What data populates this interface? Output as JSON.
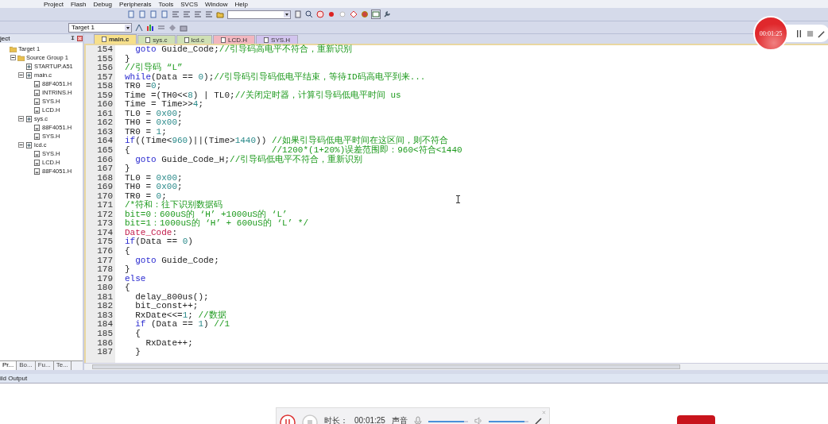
{
  "menu": [
    "Project",
    "Flash",
    "Debug",
    "Peripherals",
    "Tools",
    "SVCS",
    "Window",
    "Help"
  ],
  "target_select": {
    "value": "Target 1"
  },
  "project_panel": {
    "title": "ject",
    "tree": [
      {
        "label": "Target 1",
        "kind": "target",
        "children": [
          {
            "label": "Source Group 1",
            "kind": "group",
            "expanded": true,
            "children": [
              {
                "label": "STARTUP.A51",
                "kind": "source"
              },
              {
                "label": "main.c",
                "kind": "source",
                "expanded": true,
                "children": [
                  {
                    "label": "88F4051.H",
                    "kind": "header"
                  },
                  {
                    "label": "INTRINS.H",
                    "kind": "header"
                  },
                  {
                    "label": "SYS.H",
                    "kind": "header"
                  },
                  {
                    "label": "LCD.H",
                    "kind": "header"
                  }
                ]
              },
              {
                "label": "sys.c",
                "kind": "source",
                "expanded": true,
                "children": [
                  {
                    "label": "88F4051.H",
                    "kind": "header"
                  },
                  {
                    "label": "SYS.H",
                    "kind": "header"
                  }
                ]
              },
              {
                "label": "lcd.c",
                "kind": "source",
                "expanded": true,
                "children": [
                  {
                    "label": "SYS.H",
                    "kind": "header"
                  },
                  {
                    "label": "LCD.H",
                    "kind": "header"
                  },
                  {
                    "label": "88F4051.H",
                    "kind": "header"
                  }
                ]
              }
            ]
          }
        ]
      }
    ],
    "tabs": [
      {
        "label": "Pr...",
        "selected": true
      },
      {
        "label": "Bo...",
        "selected": false
      },
      {
        "label": "Fu...",
        "selected": false
      },
      {
        "label": "Te...",
        "selected": false
      }
    ]
  },
  "file_tabs": [
    {
      "label": "main.c",
      "selected": true,
      "color": "#f7e08a"
    },
    {
      "label": "sys.c",
      "selected": false,
      "color": "#cfe0b4"
    },
    {
      "label": "lcd.c",
      "selected": false,
      "color": "#cfe0b4"
    },
    {
      "label": "LCD.H",
      "selected": false,
      "color": "#f2b6bf"
    },
    {
      "label": "SYS.H",
      "selected": false,
      "color": "#d2c4ee"
    }
  ],
  "code": [
    {
      "no": "154",
      "segs": [
        {
          "kind": "keyword",
          "t": "  goto"
        },
        {
          "kind": "plain",
          "t": " Guide_Code;"
        },
        {
          "kind": "comment",
          "t": "//引导码高电平不符合，重新识别"
        }
      ]
    },
    {
      "no": "155",
      "segs": [
        {
          "kind": "plain",
          "t": "}"
        }
      ]
    },
    {
      "no": "156",
      "segs": [
        {
          "kind": "comment",
          "t": "//引导码 “L”"
        }
      ]
    },
    {
      "no": "157",
      "segs": [
        {
          "kind": "keyword",
          "t": "while"
        },
        {
          "kind": "plain",
          "t": "(Data == "
        },
        {
          "kind": "number",
          "t": "0"
        },
        {
          "kind": "plain",
          "t": ");"
        },
        {
          "kind": "comment",
          "t": "//引导码引导码低电平结束，等待ID码高电平到来..."
        }
      ]
    },
    {
      "no": "158",
      "segs": [
        {
          "kind": "plain",
          "t": "TR0 ="
        },
        {
          "kind": "number",
          "t": "0"
        },
        {
          "kind": "plain",
          "t": ";"
        }
      ]
    },
    {
      "no": "159",
      "segs": [
        {
          "kind": "plain",
          "t": "Time =(TH0<<"
        },
        {
          "kind": "number",
          "t": "8"
        },
        {
          "kind": "plain",
          "t": ") | TL0;"
        },
        {
          "kind": "comment",
          "t": "//关闭定时器，计算引导码低电平时间 us"
        }
      ]
    },
    {
      "no": "160",
      "segs": [
        {
          "kind": "plain",
          "t": "Time = Time>>"
        },
        {
          "kind": "number",
          "t": "4"
        },
        {
          "kind": "plain",
          "t": ";"
        }
      ]
    },
    {
      "no": "161",
      "segs": [
        {
          "kind": "plain",
          "t": "TL0 = "
        },
        {
          "kind": "number",
          "t": "0x00"
        },
        {
          "kind": "plain",
          "t": ";"
        }
      ]
    },
    {
      "no": "162",
      "segs": [
        {
          "kind": "plain",
          "t": "TH0 = "
        },
        {
          "kind": "number",
          "t": "0x00"
        },
        {
          "kind": "plain",
          "t": ";"
        }
      ]
    },
    {
      "no": "163",
      "segs": [
        {
          "kind": "plain",
          "t": "TR0 = "
        },
        {
          "kind": "number",
          "t": "1"
        },
        {
          "kind": "plain",
          "t": ";"
        }
      ]
    },
    {
      "no": "164",
      "segs": [
        {
          "kind": "keyword",
          "t": "if"
        },
        {
          "kind": "plain",
          "t": "((Time<"
        },
        {
          "kind": "number",
          "t": "960"
        },
        {
          "kind": "plain",
          "t": ")||(Time>"
        },
        {
          "kind": "number",
          "t": "1440"
        },
        {
          "kind": "plain",
          "t": ")) "
        },
        {
          "kind": "comment",
          "t": "//如果引导码低电平时间在这区间，则不符合"
        }
      ]
    },
    {
      "no": "165",
      "segs": [
        {
          "kind": "plain",
          "t": "{                           "
        },
        {
          "kind": "comment",
          "t": "//1200*(1+20%)误差范围即：960<符合<1440"
        }
      ]
    },
    {
      "no": "166",
      "segs": [
        {
          "kind": "keyword",
          "t": "  goto"
        },
        {
          "kind": "plain",
          "t": " Guide_Code_H;"
        },
        {
          "kind": "comment",
          "t": "//引导码低电平不符合，重新识别"
        }
      ]
    },
    {
      "no": "167",
      "segs": [
        {
          "kind": "plain",
          "t": "}"
        }
      ]
    },
    {
      "no": "168",
      "segs": [
        {
          "kind": "plain",
          "t": "TL0 = "
        },
        {
          "kind": "number",
          "t": "0x00"
        },
        {
          "kind": "plain",
          "t": ";"
        }
      ]
    },
    {
      "no": "169",
      "segs": [
        {
          "kind": "plain",
          "t": "TH0 = "
        },
        {
          "kind": "number",
          "t": "0x00"
        },
        {
          "kind": "plain",
          "t": ";"
        }
      ]
    },
    {
      "no": "170",
      "segs": [
        {
          "kind": "plain",
          "t": "TR0 = "
        },
        {
          "kind": "number",
          "t": "0"
        },
        {
          "kind": "plain",
          "t": ";"
        }
      ]
    },
    {
      "no": "171",
      "segs": [
        {
          "kind": "comment",
          "t": "/*符和：往下识别数据码"
        }
      ]
    },
    {
      "no": "172",
      "segs": [
        {
          "kind": "comment",
          "t": "bit=0：600uS的 ‘H’ +1000uS的 ‘L’"
        }
      ]
    },
    {
      "no": "173",
      "segs": [
        {
          "kind": "comment",
          "t": "bit=1：1000uS的 ‘H’ + 600uS的 ‘L’ */"
        }
      ]
    },
    {
      "no": "174",
      "segs": [
        {
          "kind": "label",
          "t": "Date_Code"
        },
        {
          "kind": "plain",
          "t": ":"
        }
      ]
    },
    {
      "no": "175",
      "segs": [
        {
          "kind": "keyword",
          "t": "if"
        },
        {
          "kind": "plain",
          "t": "(Data == "
        },
        {
          "kind": "number",
          "t": "0"
        },
        {
          "kind": "plain",
          "t": ")"
        }
      ]
    },
    {
      "no": "176",
      "segs": [
        {
          "kind": "plain",
          "t": "{"
        }
      ]
    },
    {
      "no": "177",
      "segs": [
        {
          "kind": "keyword",
          "t": "  goto"
        },
        {
          "kind": "plain",
          "t": " Guide_Code;"
        }
      ]
    },
    {
      "no": "178",
      "segs": [
        {
          "kind": "plain",
          "t": "}"
        }
      ]
    },
    {
      "no": "179",
      "segs": [
        {
          "kind": "keyword",
          "t": "else"
        }
      ]
    },
    {
      "no": "180",
      "segs": [
        {
          "kind": "plain",
          "t": "{"
        }
      ]
    },
    {
      "no": "181",
      "segs": [
        {
          "kind": "plain",
          "t": "  delay_800us();"
        }
      ]
    },
    {
      "no": "182",
      "segs": [
        {
          "kind": "plain",
          "t": "  bit_const++;"
        }
      ]
    },
    {
      "no": "183",
      "segs": [
        {
          "kind": "plain",
          "t": "  RxDate<<="
        },
        {
          "kind": "number",
          "t": "1"
        },
        {
          "kind": "plain",
          "t": "; "
        },
        {
          "kind": "comment",
          "t": "//数据"
        }
      ]
    },
    {
      "no": "184",
      "segs": [
        {
          "kind": "keyword",
          "t": "  if"
        },
        {
          "kind": "plain",
          "t": " (Data == "
        },
        {
          "kind": "number",
          "t": "1"
        },
        {
          "kind": "plain",
          "t": ") "
        },
        {
          "kind": "comment",
          "t": "//1"
        }
      ]
    },
    {
      "no": "185",
      "segs": [
        {
          "kind": "plain",
          "t": "  {"
        }
      ]
    },
    {
      "no": "186",
      "segs": [
        {
          "kind": "plain",
          "t": "    RxDate++;"
        }
      ]
    },
    {
      "no": "187",
      "segs": [
        {
          "kind": "plain",
          "t": "  }"
        }
      ]
    }
  ],
  "output_panel": {
    "title": "ild Output"
  },
  "recorder_badge": {
    "time": "00:01:25"
  },
  "recorder_bar": {
    "duration_label": "时长：",
    "duration": "00:01:25",
    "sound_label": "声音",
    "mic_level": {
      "level": 0.9
    },
    "speaker_level": {
      "level": 0.9
    }
  }
}
